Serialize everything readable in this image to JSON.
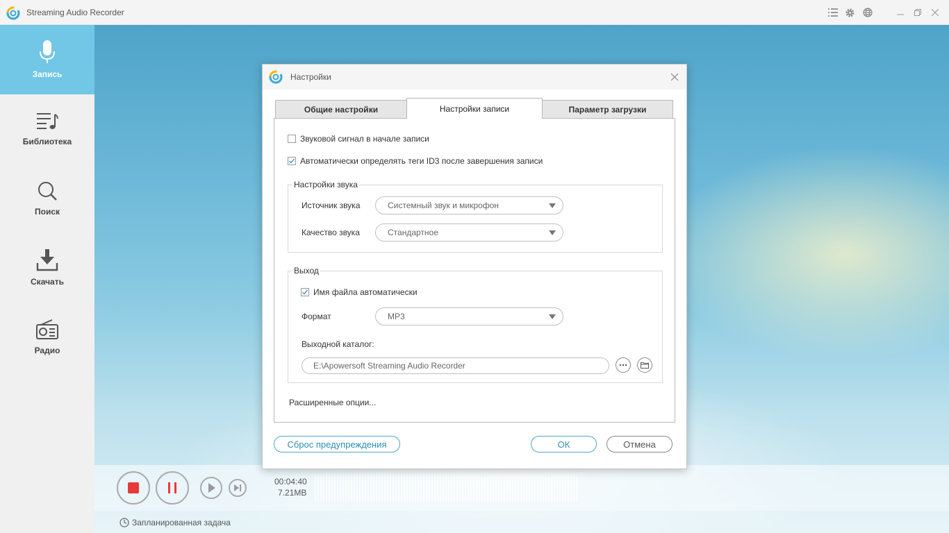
{
  "app": {
    "title": "Streaming Audio Recorder",
    "accent_color": "#71c7e5"
  },
  "titlebar_icons": [
    "list-icon",
    "gear-icon",
    "globe-icon",
    "minimize-icon",
    "restore-icon",
    "close-icon"
  ],
  "sidebar": {
    "items": [
      {
        "label": "Запись",
        "icon": "microphone-icon",
        "active": true
      },
      {
        "label": "Библиотека",
        "icon": "music-list-icon",
        "active": false
      },
      {
        "label": "Поиск",
        "icon": "search-icon",
        "active": false
      },
      {
        "label": "Скачать",
        "icon": "download-icon",
        "active": false
      },
      {
        "label": "Радио",
        "icon": "radio-icon",
        "active": false
      }
    ]
  },
  "player": {
    "time": "00:04:40",
    "size": "7.21MB",
    "scheduled_task": "Запланированная задача",
    "record_color": "#e8393a"
  },
  "dialog": {
    "title": "Настройки",
    "tabs": [
      {
        "label": "Общие настройки",
        "active": false
      },
      {
        "label": "Настройки записи",
        "active": true
      },
      {
        "label": "Параметр загрузки",
        "active": false
      }
    ],
    "options": {
      "beep_on_start": {
        "label": "Звуковой сигнал в начале записи",
        "checked": false
      },
      "auto_id3": {
        "label": "Автоматически определять теги ID3  после завершения записи",
        "checked": true
      }
    },
    "sound_settings": {
      "group_label": "Настройки звука",
      "source_label": "Источник звука",
      "source_value": "Системный звук и микрофон",
      "quality_label": "Качество звука",
      "quality_value": "Стандартное"
    },
    "output": {
      "group_label": "Выход",
      "auto_filename": {
        "label": "Имя файла автоматически",
        "checked": true
      },
      "format_label": "Формат",
      "format_value": "MP3",
      "dir_label": "Выходной каталог:",
      "dir_value": "E:\\Apowersoft Streaming Audio Recorder"
    },
    "advanced_label": "Расширенные опции...",
    "buttons": {
      "reset": "Сброс предупреждения",
      "ok": "ОК",
      "cancel": "Отмена"
    }
  }
}
